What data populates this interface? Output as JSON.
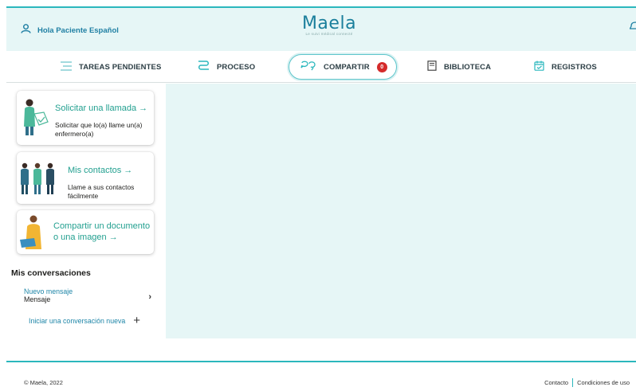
{
  "header": {
    "greeting": "Hola Paciente Español",
    "logo_text": "Maela",
    "logo_tagline": "Le suivi médical connecté",
    "accent_color": "#2bb7bd"
  },
  "tabs": [
    {
      "label": "TAREAS PENDIENTES",
      "icon": "list-icon"
    },
    {
      "label": "PROCESO",
      "icon": "path-icon"
    },
    {
      "label": "COMPARTIR",
      "icon": "chat-icon",
      "active": true,
      "badge": "0"
    },
    {
      "label": "BIBLIOTECA",
      "icon": "book-icon"
    },
    {
      "label": "REGISTROS",
      "icon": "calendar-check-icon"
    }
  ],
  "cards": {
    "call": {
      "title": "Solicitar una llamada",
      "subtitle": "Solicitar que lo(a) llame un(a) enfermero(a)"
    },
    "contacts": {
      "title": "Mis contactos",
      "subtitle": "Llame a sus contactos fácilmente"
    },
    "share": {
      "title": "Compartir un documento o una imagen"
    }
  },
  "conversations": {
    "heading": "Mis conversaciones",
    "items": [
      {
        "title": "Nuevo mensaje",
        "subtitle": "Mensaje"
      }
    ],
    "new_label": "Iniciar una conversación nueva"
  },
  "footer": {
    "copyright": "© Maela, 2022",
    "contact": "Contacto",
    "terms": "Condiciones de uso"
  }
}
